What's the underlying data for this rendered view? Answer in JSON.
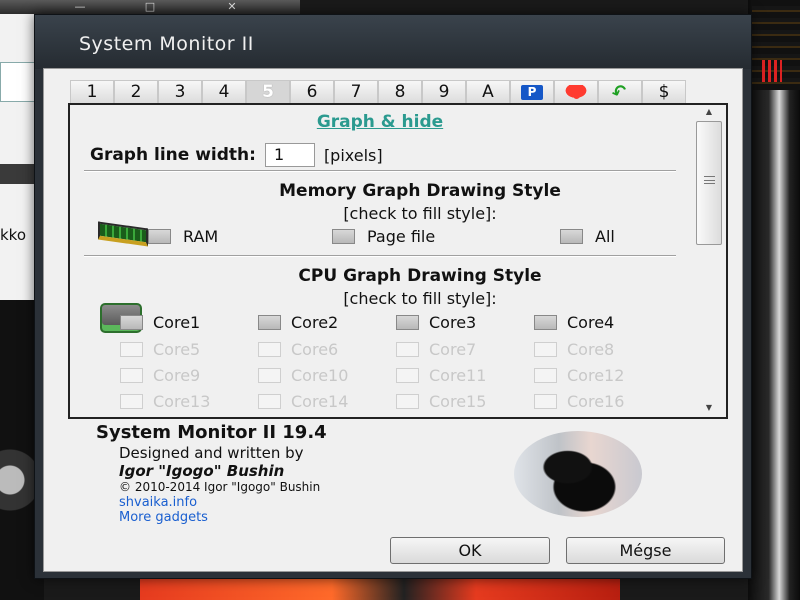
{
  "window": {
    "title": "System Monitor II"
  },
  "background": {
    "partial_text": "kko"
  },
  "tabs": [
    {
      "label": "1"
    },
    {
      "label": "2"
    },
    {
      "label": "3"
    },
    {
      "label": "4"
    },
    {
      "label": "5",
      "active": true
    },
    {
      "label": "6"
    },
    {
      "label": "7"
    },
    {
      "label": "8"
    },
    {
      "label": "9"
    },
    {
      "label": "A"
    },
    {
      "label": "P",
      "icon": "p-badge-icon"
    },
    {
      "label": "",
      "icon": "lips-icon"
    },
    {
      "label": "↶",
      "icon": "undo-arrow-icon"
    },
    {
      "label": "$"
    }
  ],
  "panel": {
    "heading": "Graph & hide",
    "line_width": {
      "label": "Graph line width:",
      "value": "1",
      "unit": "[pixels]"
    },
    "memory": {
      "icon": "ram-module-icon",
      "title": "Memory Graph Drawing Style",
      "subtitle": "[check to fill style]:",
      "options": [
        {
          "label": "RAM",
          "checked": false
        },
        {
          "label": "Page file",
          "checked": false
        },
        {
          "label": "All",
          "checked": false
        }
      ]
    },
    "cpu": {
      "icon": "cpu-icon",
      "title": "CPU Graph Drawing Style",
      "subtitle": "[check to fill style]:",
      "cores": [
        {
          "label": "Core1",
          "enabled": true
        },
        {
          "label": "Core2",
          "enabled": true
        },
        {
          "label": "Core3",
          "enabled": true
        },
        {
          "label": "Core4",
          "enabled": true
        },
        {
          "label": "Core5",
          "enabled": false
        },
        {
          "label": "Core6",
          "enabled": false
        },
        {
          "label": "Core7",
          "enabled": false
        },
        {
          "label": "Core8",
          "enabled": false
        },
        {
          "label": "Core9",
          "enabled": false
        },
        {
          "label": "Core10",
          "enabled": false
        },
        {
          "label": "Core11",
          "enabled": false
        },
        {
          "label": "Core12",
          "enabled": false
        },
        {
          "label": "Core13",
          "enabled": false
        },
        {
          "label": "Core14",
          "enabled": false
        },
        {
          "label": "Core15",
          "enabled": false
        },
        {
          "label": "Core16",
          "enabled": false
        }
      ]
    }
  },
  "about": {
    "title": "System Monitor II 19.4",
    "designed": "Designed and written by",
    "author": "Igor \"Igogo\" Bushin",
    "copyright": "© 2010-2014 Igor \"Igogo\" Bushin",
    "link1": "shvaika.info",
    "link2": "More gadgets",
    "avatar": "cat-photo-avatar"
  },
  "buttons": {
    "ok": "OK",
    "cancel": "Mégse"
  },
  "colors": {
    "link_heading": "#2b9a8f",
    "link": "#1a5fd0",
    "titlebar": "#2b3138",
    "p_badge": "#1557c7",
    "lips": "#ff3b30",
    "undo": "#1fa023"
  }
}
